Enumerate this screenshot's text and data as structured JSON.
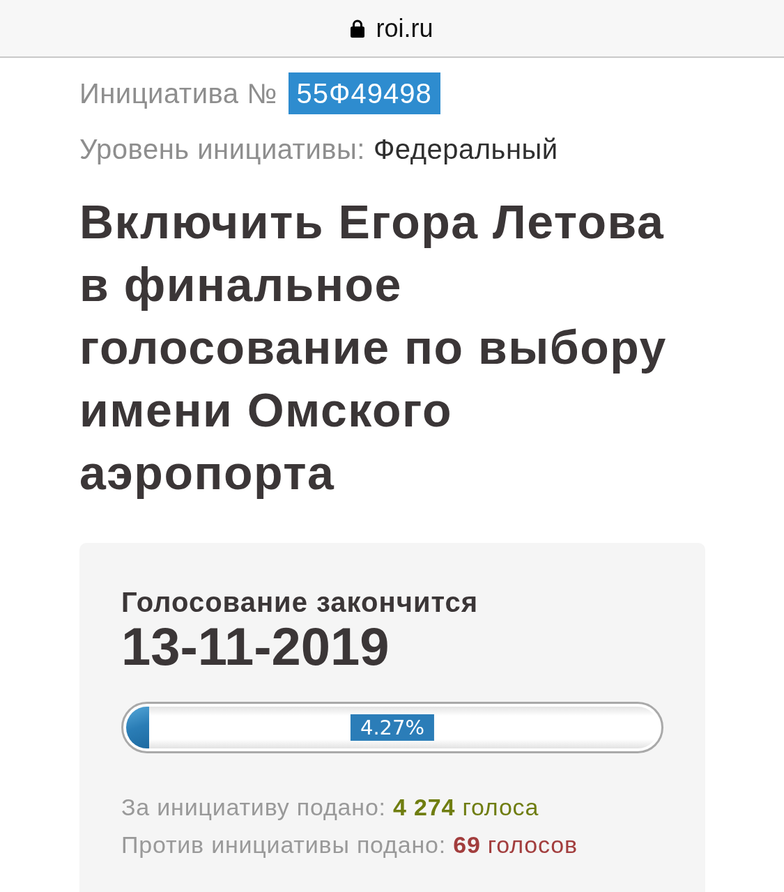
{
  "address_bar": {
    "url": "roi.ru",
    "secure": true
  },
  "initiative": {
    "label": "Инициатива №",
    "number": "55Ф49498"
  },
  "level_line": {
    "label": "Уровень инициативы:",
    "value": "Федеральный"
  },
  "title": "Включить Егора Летова в финальное голосование по выбору имени Омского аэропорта",
  "voting": {
    "ends_label": "Голосование закончится",
    "end_date": "13-11-2019",
    "progress": {
      "level": 0.0427,
      "reading": "4.27%"
    },
    "votes": [
      {
        "label": "За инициативу подано:",
        "count": "4 274",
        "unit": "голоса",
        "color": "#6f7d10"
      },
      {
        "label": "Против инициативы подано:",
        "count": "69",
        "unit": "голосов",
        "color": "#a23d3d"
      }
    ]
  }
}
